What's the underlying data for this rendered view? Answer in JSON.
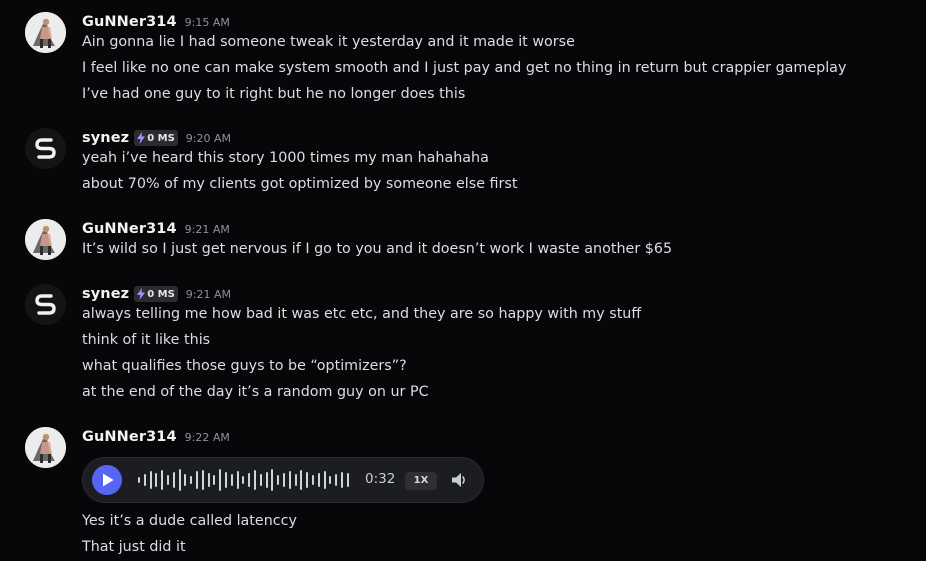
{
  "messages": [
    {
      "author": "GuNNer314",
      "avatar": "photo-avatar",
      "time": "9:15 AM",
      "lines": [
        "Ain gonna lie I had someone tweak it yesterday and it made it worse",
        "I feel like no one can make system smooth and I just pay and get no thing in return but crappier gameplay",
        "I’ve had one guy to it right but he no longer does this"
      ]
    },
    {
      "author": "synez",
      "avatar": "synez-logo",
      "tag": "0 MS",
      "time": "9:20 AM",
      "lines": [
        "yeah i’ve heard this story 1000 times my man hahahaha",
        "about 70% of my clients got optimized by someone else first"
      ]
    },
    {
      "author": "GuNNer314",
      "avatar": "photo-avatar",
      "time": "9:21 AM",
      "lines": [
        "It’s wild so I just get nervous if I go to you and it doesn’t work I waste another $65"
      ]
    },
    {
      "author": "synez",
      "avatar": "synez-logo",
      "tag": "0 MS",
      "time": "9:21 AM",
      "lines": [
        "always telling me how bad it was etc etc, and they are so happy with my stuff",
        "think of it like this",
        "what qualifies those guys to be “optimizers”?",
        "at the end of the day it’s a random guy on ur PC"
      ]
    },
    {
      "author": "GuNNer314",
      "avatar": "photo-avatar",
      "time": "9:22 AM",
      "voice": {
        "duration": "0:32",
        "speed": "1X",
        "play_icon": "play-icon",
        "volume_icon": "speaker-icon"
      },
      "lines": [
        "Yes it’s a dude called latenccy",
        "That just did it"
      ]
    }
  ],
  "colors": {
    "background": "#070709",
    "accent": "#5865f2",
    "tag_bolt": "#b18cff"
  }
}
